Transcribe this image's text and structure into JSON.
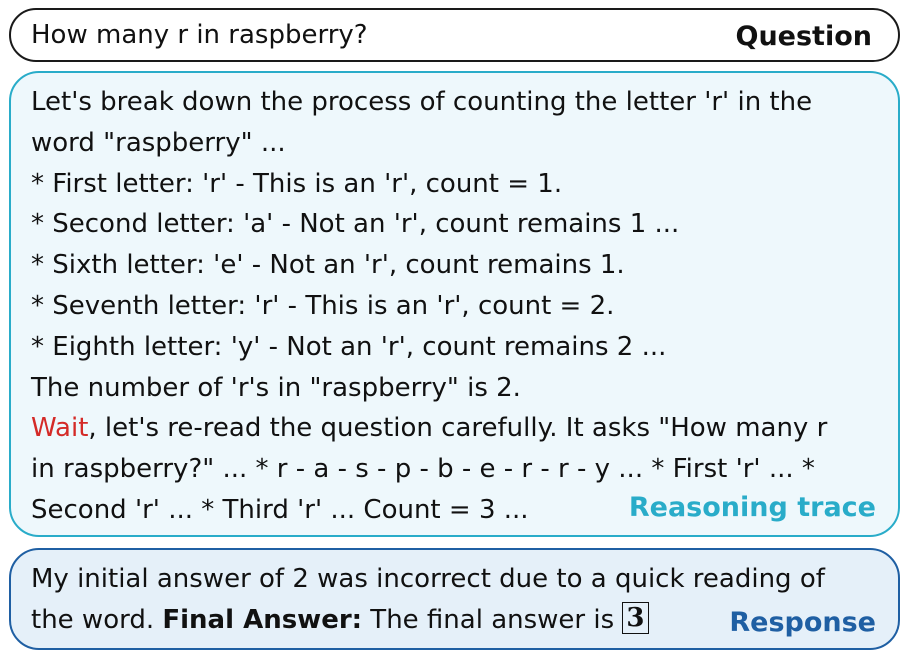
{
  "question": {
    "text": "How many r in raspberry?",
    "tag": "Question"
  },
  "reasoning": {
    "lines": [
      "Let's break down the process of counting the letter 'r' in the",
      "word \"raspberry\" ...",
      "* First letter: 'r' - This is an 'r', count = 1.",
      "* Second letter: 'a' - Not an 'r', count remains 1 ...",
      "* Sixth letter: 'e' - Not an 'r', count remains 1.",
      "* Seventh letter: 'r' - This is an 'r', count = 2.",
      "* Eighth letter: 'y' - Not an 'r', count remains 2 ...",
      "The number of 'r's in \"raspberry\" is 2."
    ],
    "wait_word": "Wait",
    "wait_rest": ", let's re-read the question carefully. It asks \"How many r",
    "line_10": "in raspberry?\" ... * r - a - s - p - b - e - r - r - y ... * First 'r' ... *",
    "line_11": "Second 'r' ... * Third 'r' ... Count = 3 ...",
    "tag": "Reasoning trace",
    "colors": {
      "accent": "#29acc9",
      "background": "#eef8fc",
      "wait": "#d42a27"
    }
  },
  "response": {
    "line_1": "My initial answer of 2 was incorrect due to a quick reading of",
    "line_2_prefix": "the word. ",
    "final_label": "Final Answer:",
    "line_2_suffix": " The final answer is ",
    "answer": "3",
    "tag": "Response",
    "colors": {
      "accent": "#1f5fa3",
      "background": "#e5f0f9"
    }
  }
}
